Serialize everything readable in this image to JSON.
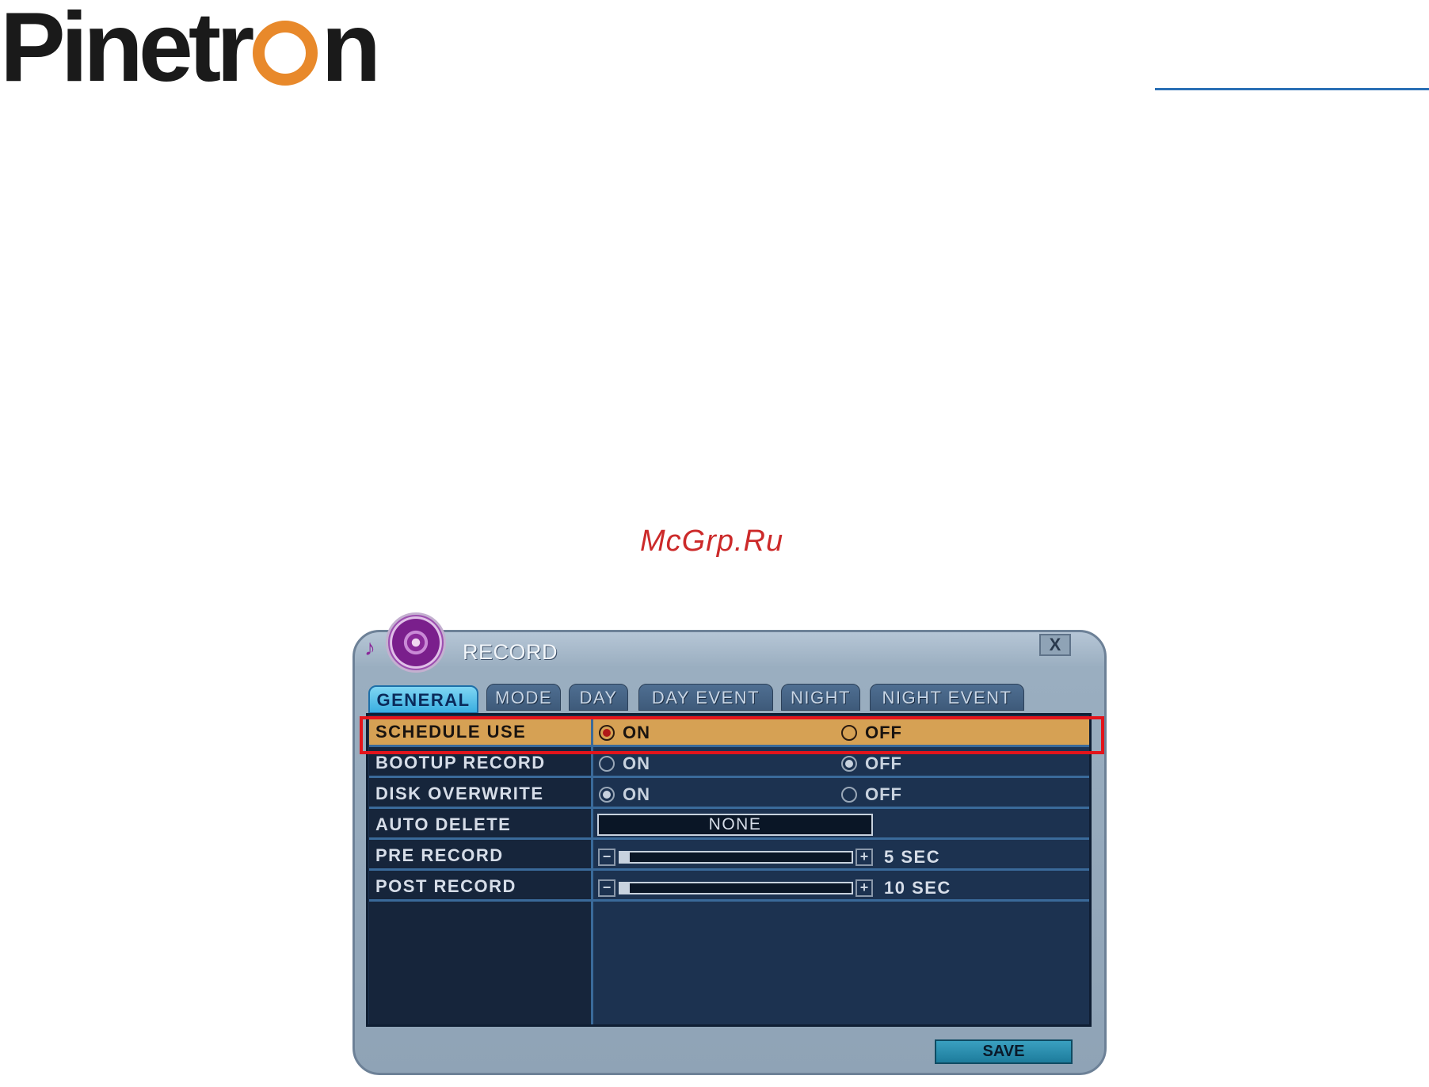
{
  "brand": {
    "logo_left": "Pinetr",
    "logo_right": "n",
    "accent_color": "#e8892b",
    "rule_color": "#2a6fb5"
  },
  "watermark": "McGrp.Ru",
  "dialog": {
    "title": "RECORD",
    "close_label": "X",
    "icon": "film-reel-icon"
  },
  "tabs": [
    {
      "label": "GENERAL",
      "active": true
    },
    {
      "label": "MODE",
      "active": false
    },
    {
      "label": "DAY",
      "active": false
    },
    {
      "label": "DAY EVENT",
      "active": false
    },
    {
      "label": "NIGHT",
      "active": false
    },
    {
      "label": "NIGHT EVENT",
      "active": false
    }
  ],
  "settings": {
    "schedule_use": {
      "label": "SCHEDULE USE",
      "on_label": "ON",
      "off_label": "OFF",
      "value": "ON",
      "highlighted": true
    },
    "bootup_record": {
      "label": "BOOTUP RECORD",
      "on_label": "ON",
      "off_label": "OFF",
      "value": "OFF"
    },
    "disk_overwrite": {
      "label": "DISK OVERWRITE",
      "on_label": "ON",
      "off_label": "OFF",
      "value": "ON"
    },
    "auto_delete": {
      "label": "AUTO DELETE",
      "value": "NONE"
    },
    "pre_record": {
      "label": "PRE RECORD",
      "value": "5 SEC",
      "minus": "−",
      "plus": "+",
      "level": 0.01
    },
    "post_record": {
      "label": "POST RECORD",
      "value": "10 SEC",
      "minus": "−",
      "plus": "+",
      "level": 0.03
    }
  },
  "footer": {
    "save_label": "SAVE"
  },
  "colors": {
    "highlight_row": "#d6a154",
    "selection_frame": "#e3141b",
    "panel": "#1c3250",
    "active_tab": "#3aaee0"
  }
}
